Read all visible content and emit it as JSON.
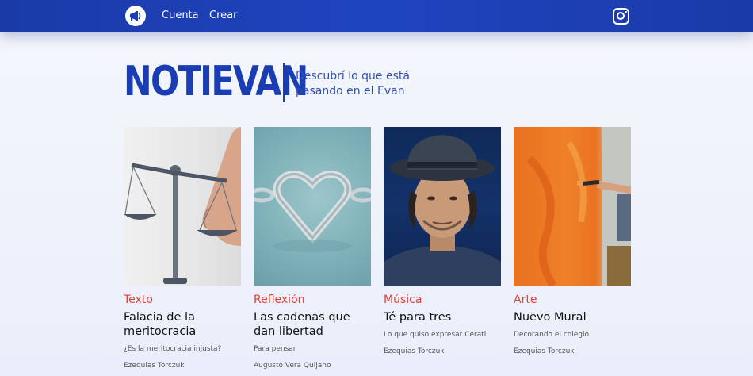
{
  "nav": {
    "links": [
      "Cuenta",
      "Crear"
    ],
    "logo_icon": "megaphone-icon",
    "social_icon": "instagram-icon"
  },
  "header": {
    "brand": "NOTIEVAN",
    "tagline": "Descubrí lo que está pasando en el Evan"
  },
  "colors": {
    "primary": "#1a3db3",
    "category": "#e0413a"
  },
  "cards": [
    {
      "category": "Texto",
      "title": "Falacia de la meritocracia",
      "subtitle": "¿Es la meritocracia injusta?",
      "author": "Ezequias Torczuk",
      "image": "scale-balance-finger"
    },
    {
      "category": "Reflexión",
      "title": "Las cadenas que dan libertad",
      "subtitle": "Para pensar",
      "author": "Augusto Vera Quijano",
      "image": "heart-chain"
    },
    {
      "category": "Música",
      "title": "Té para tres",
      "subtitle": "Lo que quiso expresar Cerati",
      "author": "Ezequias Torczuk",
      "image": "man-with-hat"
    },
    {
      "category": "Arte",
      "title": "Nuevo Mural",
      "subtitle": "Decorando el colegio",
      "author": "Ezequias Torczuk",
      "image": "painting-mural"
    }
  ]
}
